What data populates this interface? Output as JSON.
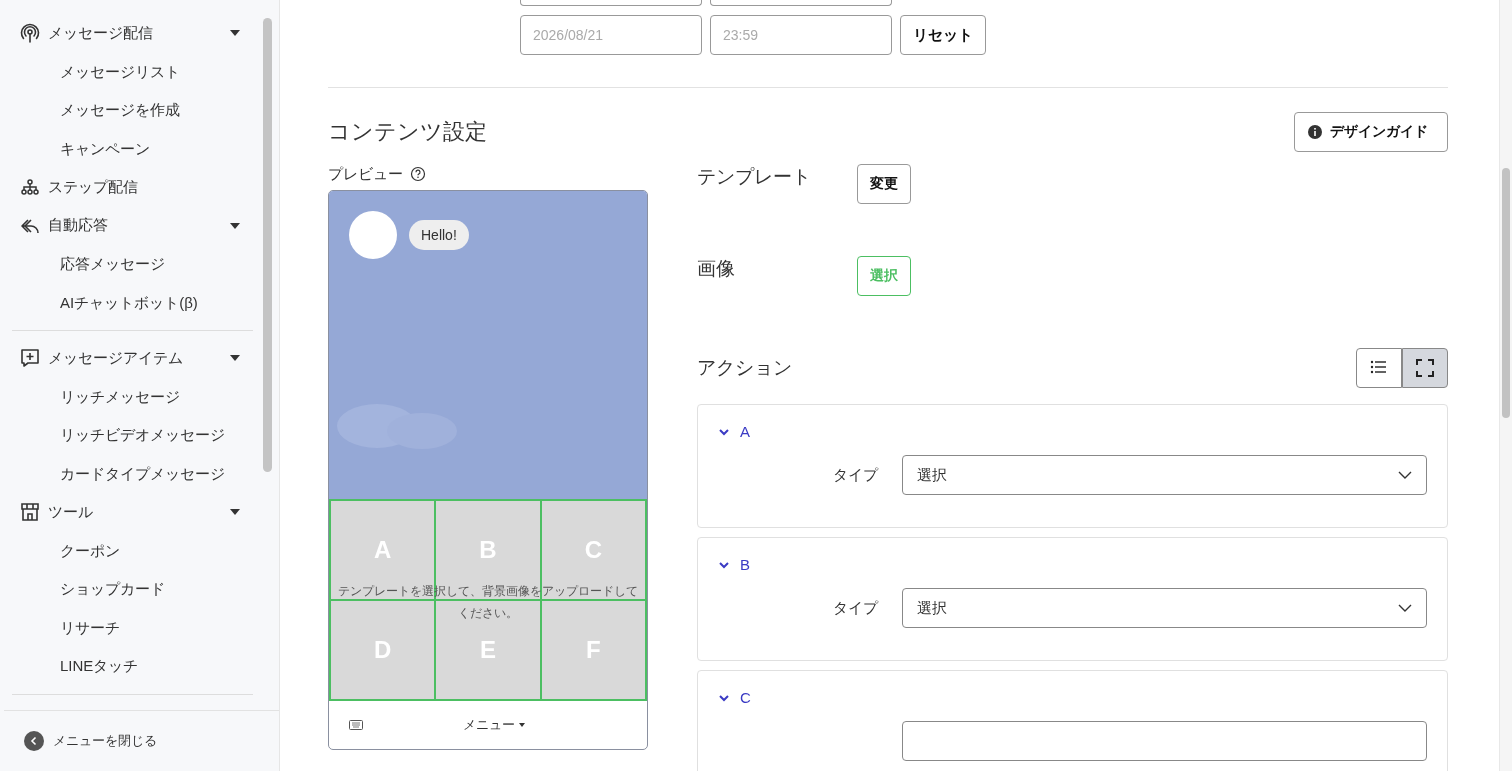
{
  "sidebar": {
    "sections": [
      [
        {
          "label": "メッセージ配信",
          "expanded": true,
          "children": [
            {
              "label": "メッセージリスト"
            },
            {
              "label": "メッセージを作成"
            },
            {
              "label": "キャンペーン"
            }
          ]
        },
        {
          "label": "ステップ配信"
        },
        {
          "label": "自動応答",
          "expanded": true,
          "children": [
            {
              "label": "応答メッセージ"
            },
            {
              "label": "AIチャットボット(β)"
            }
          ]
        }
      ],
      [
        {
          "label": "メッセージアイテム",
          "expanded": true,
          "children": [
            {
              "label": "リッチメッセージ"
            },
            {
              "label": "リッチビデオメッセージ"
            },
            {
              "label": "カードタイプメッセージ"
            }
          ]
        },
        {
          "label": "ツール",
          "expanded": true,
          "children": [
            {
              "label": "クーポン"
            },
            {
              "label": "ショップカード"
            },
            {
              "label": "リサーチ"
            },
            {
              "label": "LINEタッチ"
            }
          ]
        }
      ]
    ],
    "close_menu": "メニューを閉じる"
  },
  "period": {
    "end_date": {
      "placeholder": "2026/08/21"
    },
    "end_time": {
      "placeholder": "23:59"
    },
    "reset_button": "リセット"
  },
  "content": {
    "title": "コンテンツ設定",
    "design_guide_button": "デザインガイド",
    "preview": {
      "label": "プレビュー",
      "bubble": "Hello!",
      "areas": [
        "A",
        "B",
        "C",
        "D",
        "E",
        "F"
      ],
      "hint": "テンプレートを選択して、背景画像をアップロードしてください。",
      "menu_label": "メニュー"
    },
    "template": {
      "label": "テンプレート",
      "button": "変更"
    },
    "image": {
      "label": "画像",
      "button": "選択"
    },
    "actions": {
      "label": "アクション",
      "views": [
        {
          "kind": "list",
          "selected": false
        },
        {
          "kind": "grid",
          "selected": true
        }
      ],
      "items": [
        {
          "label": "A",
          "expanded": true,
          "type_label": "タイプ",
          "type_value": "選択"
        },
        {
          "label": "B",
          "expanded": true,
          "type_label": "タイプ",
          "type_value": "選択"
        },
        {
          "label": "C",
          "expanded": true
        }
      ]
    }
  }
}
